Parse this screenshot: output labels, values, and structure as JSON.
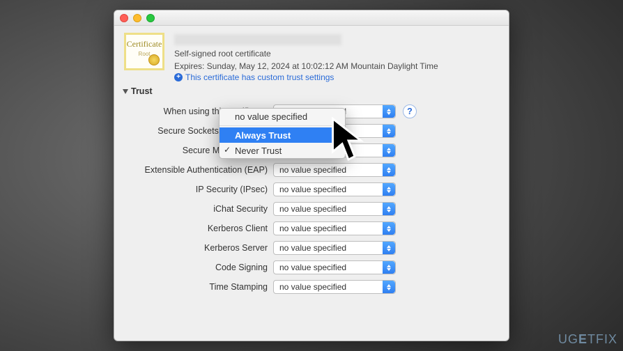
{
  "window": {
    "name_placeholder": true
  },
  "cert_icon": {
    "word": "Certificate",
    "root": "Root"
  },
  "header": {
    "subtitle": "Self-signed root certificate",
    "expires": "Expires: Sunday, May 12, 2024 at 10:02:12 AM Mountain Daylight Time",
    "custom_trust": "This certificate has custom trust settings"
  },
  "trust_section_label": "Trust",
  "help_label": "?",
  "dropdown": {
    "options": {
      "none": "no value specified",
      "always": "Always Trust",
      "never": "Never Trust"
    },
    "checked": "never",
    "highlighted": "always"
  },
  "rows": [
    {
      "label": "When using this certificate:",
      "value": "no value specified",
      "show_help": true
    },
    {
      "label": "Secure Sockets Layer (SSL)",
      "value": "no value specified"
    },
    {
      "label": "Secure Mail (S/MIME)",
      "value": "no value specified"
    },
    {
      "label": "Extensible Authentication (EAP)",
      "value": "no value specified"
    },
    {
      "label": "IP Security (IPsec)",
      "value": "no value specified"
    },
    {
      "label": "iChat Security",
      "value": "no value specified"
    },
    {
      "label": "Kerberos Client",
      "value": "no value specified"
    },
    {
      "label": "Kerberos Server",
      "value": "no value specified"
    },
    {
      "label": "Code Signing",
      "value": "no value specified"
    },
    {
      "label": "Time Stamping",
      "value": "no value specified"
    }
  ],
  "watermark": "UGETFIX"
}
